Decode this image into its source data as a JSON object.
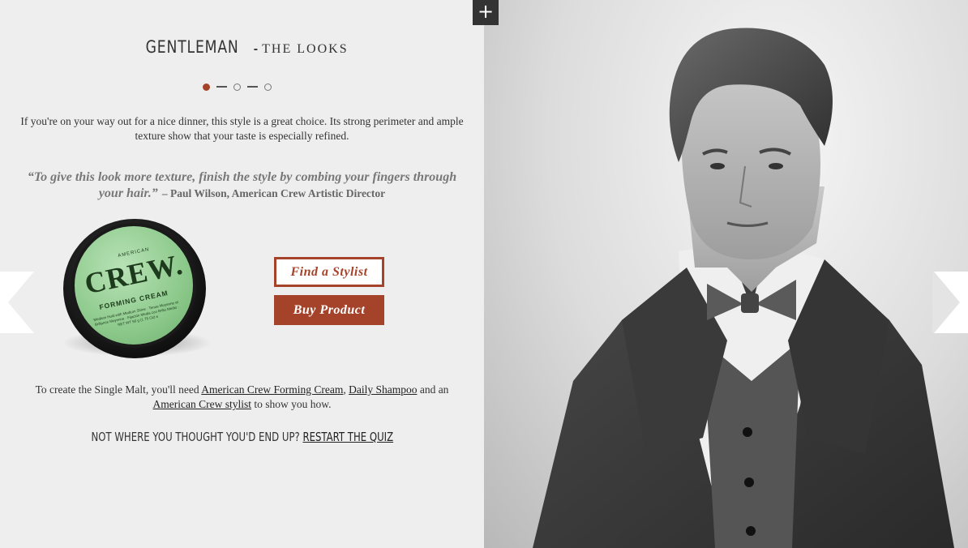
{
  "header": {
    "title_main": "GENTLEMAN",
    "title_sep": "-",
    "title_sub": "THE LOOKS",
    "plus_label": "+"
  },
  "pagination": {
    "current": 1,
    "total": 3
  },
  "intro_text": "If you're on your way out for a nice dinner, this style is a great choice. Its strong perimeter and ample texture show that your taste is especially refined.",
  "quote": {
    "text": "“To give this look more texture, finish the style by combing your fingers through your hair.”",
    "author": "– Paul Wilson, American Crew Artistic Director"
  },
  "product": {
    "brand_top": "AMERICAN",
    "brand": "CREW.",
    "name": "FORMING CREAM",
    "fine_print": "Medium Hold with Medium Shine · Tenue Moyenne et Brillance Moyenne · Fijación Media con Brillo Medio · NET WT 50 g (1.75 Oz) e"
  },
  "buttons": {
    "find_stylist": "Find a Stylist",
    "buy_product": "Buy Product"
  },
  "needs": {
    "prefix": "To create the Single Malt, you'll need ",
    "link1": "American Crew Forming Cream",
    "sep1": ", ",
    "link2": "Daily Shampoo",
    "sep2": " and an ",
    "link3": "American Crew stylist",
    "suffix": " to show you how."
  },
  "restart": {
    "prompt": "NOT WHERE YOU THOUGHT YOU'D END UP? ",
    "link": "RESTART THE QUIZ"
  },
  "colors": {
    "accent": "#a5432a",
    "background": "#eeeeee",
    "text": "#333333"
  },
  "icons": {
    "nav_left": "chevron-left-icon",
    "nav_right": "chevron-right-icon",
    "expand": "plus-icon"
  }
}
